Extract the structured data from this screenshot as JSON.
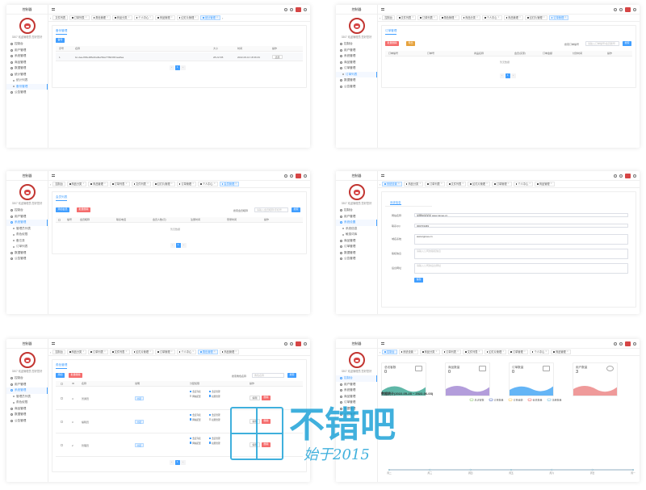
{
  "app_title": "控制器",
  "user_line": "3307 欢迎管理员 您好您好",
  "menu": {
    "console": "控制台",
    "user_mgmt": "用户管理",
    "system_mgmt": "系统管理",
    "goods_mgmt": "商品管理",
    "order_mgmt": "订单管理",
    "data_mgmt": "数据管理",
    "stats": "统计管理",
    "sys_setting": "系统设置",
    "announce": "公告管理",
    "system_info": "系统信息",
    "sensitive_words": "敏感词库",
    "sub_filelist": "统计列表",
    "sub_backup": "备份管理",
    "sub_admin": "管理员列表",
    "sub_role": "角色权限",
    "sub_memo": "备忘录",
    "sub_order": "订单列表"
  },
  "tabs": {
    "console": "控制台",
    "file_list": "文件列表",
    "order_list": "订单列表",
    "role_mgmt": "角色管理",
    "goods_cat": "商品分类",
    "personal": "个人中心",
    "goods": "商品管理",
    "slides": "幻灯片管理",
    "sys_setting": "系统设置",
    "orders": "订单管理",
    "stats": "统计管理",
    "members": "会员管理",
    "admins": "管理员列表",
    "perm": "权限管理"
  },
  "p1": {
    "title": "备份管理",
    "btn": "备份",
    "cols": [
      "序号",
      "名称",
      "大小",
      "时间",
      "操作"
    ],
    "row": {
      "idx": "1",
      "name": "bc-dea-8b5e0f8e0ba8e25da77f6b6b51ea8ea",
      "size": "28.22 KB",
      "time": "2022-06-10 18:36:29",
      "op": "还原"
    },
    "page": "1"
  },
  "p2": {
    "title": "订单管理",
    "btn_del": "批量删除",
    "btn_export": "导出",
    "search_label": "搜索订单编号",
    "search_placeholder": "请输入订单编号/会员账号",
    "search_btn": "搜索",
    "cols": [
      "订单编号",
      "订单号",
      "商品名称",
      "会员(买家)",
      "订单金额",
      "付款时间",
      "操作"
    ],
    "empty": "暂无数据",
    "page": "1"
  },
  "p3": {
    "title": "会员列表",
    "btn_add": "添加会员",
    "btn_del": "批量删除",
    "search_label": "搜索会员昵称",
    "search_placeholder": "请输入会员昵称/手机号",
    "search_btn": "搜索",
    "cols": [
      "编号",
      "会员昵称",
      "联系电话",
      "会员人数(元)",
      "注册时间",
      "登录时间",
      "操作"
    ],
    "empty": "暂无数据",
    "page": "1"
  },
  "p4": {
    "tab": "系统信息",
    "fields": [
      {
        "label": "网站名称",
        "value": "某网站某某某 www.tgmao.cn"
      },
      {
        "label": "联系QQ",
        "value": "300703469"
      },
      {
        "label": "域名系统",
        "value": "www.tgmao.cn"
      },
      {
        "label": "版权信息",
        "value": "请输入公司的版权信息"
      },
      {
        "label": "后台网址",
        "value": "请输入公司的后台网址"
      }
    ],
    "save_btn": "保存"
  },
  "p5": {
    "title": "角色管理",
    "btn_add": "添加",
    "btn_del": "批量删除",
    "search_label": "搜索角色名称",
    "search_placeholder": "角色名称",
    "search_btn": "搜索",
    "cols": [
      "",
      "ID",
      "名称",
      "说明",
      "分配权限",
      "操作"
    ],
    "rows": [
      {
        "id": "4",
        "name": "普通员",
        "tag": "分配",
        "perms": [
          "会员列表",
          "会员管理",
          "网站配置",
          "权限管理"
        ]
      },
      {
        "id": "3",
        "name": "编辑员",
        "tag": "分配",
        "perms": [
          "会员列表",
          "会员管理",
          "网站配置",
          "权限管理"
        ]
      },
      {
        "id": "2",
        "name": "管理员",
        "tag": "分配",
        "perms": [
          "会员列表",
          "会员管理",
          "网站配置",
          "权限管理"
        ]
      }
    ],
    "btn_edit": "编辑",
    "btn_remove": "删除",
    "page": "1"
  },
  "p6": {
    "cards": [
      {
        "label": "总访客数",
        "value": "0",
        "color": "#5fb7a7"
      },
      {
        "label": "商品数量",
        "value": "0",
        "color": "#b39ddb"
      },
      {
        "label": "订单数量",
        "value": "0",
        "color": "#64b5f6"
      },
      {
        "label": "用户数量",
        "value": "3",
        "color": "#ef9a9a"
      }
    ],
    "chart_title": "数据统计(2022-05-28 ~ 2022-06-03)",
    "chart_data": {
      "type": "line",
      "title": "数据统计(2022-05-28 ~ 2022-06-03)",
      "series": [
        {
          "name": "总访客数",
          "values": [
            0,
            0,
            0,
            0,
            0,
            0,
            0
          ]
        },
        {
          "name": "订单数量",
          "values": [
            0,
            0,
            0,
            0,
            0,
            0,
            0
          ]
        },
        {
          "name": "订单金额",
          "values": [
            0,
            0,
            0,
            0,
            0,
            0,
            0
          ]
        },
        {
          "name": "会员数量",
          "values": [
            0,
            0,
            0,
            0,
            0,
            0,
            0
          ]
        },
        {
          "name": "注册数量",
          "values": [
            0,
            0,
            0,
            0,
            0,
            0,
            0
          ]
        }
      ],
      "categories": [
        "周二",
        "周三",
        "周四",
        "周五",
        "周六",
        "周日",
        "周一"
      ],
      "colors": [
        "#91cc75",
        "#5470c6",
        "#fac858",
        "#ee6666",
        "#73c0de"
      ]
    }
  },
  "watermark": {
    "main": "不错吧",
    "sub": "始于2015",
    "color": "#1fa3d8"
  }
}
